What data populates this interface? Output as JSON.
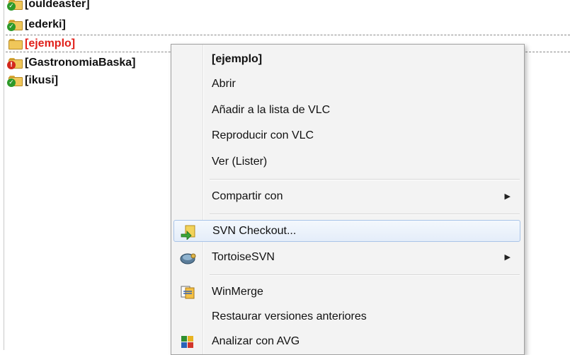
{
  "files": [
    {
      "label": "[ouldeaster]",
      "badge": "ok",
      "selected": false
    },
    {
      "label": "[ederki]",
      "badge": "ok",
      "selected": false
    },
    {
      "label": "[ejemplo]",
      "badge": "none",
      "selected": true
    },
    {
      "label": "[GastronomiaBaska]",
      "badge": "warn",
      "selected": false
    },
    {
      "label": "[ikusi]",
      "badge": "ok",
      "selected": false
    }
  ],
  "context_menu": {
    "items": [
      {
        "label": "[ejemplo]",
        "bold": true
      },
      {
        "label": "Abrir"
      },
      {
        "label": "Añadir a la lista de VLC"
      },
      {
        "label": "Reproducir con VLC"
      },
      {
        "label": "Ver (Lister)"
      },
      {
        "label": "Compartir con",
        "submenu": true
      },
      {
        "label": "SVN Checkout...",
        "highlighted": true,
        "icon": "svn-checkout-icon"
      },
      {
        "label": "TortoiseSVN",
        "submenu": true,
        "icon": "tortoisesvn-icon"
      },
      {
        "label": "WinMerge",
        "icon": "winmerge-icon"
      },
      {
        "label": "Restaurar versiones anteriores"
      },
      {
        "label": "Analizar con AVG",
        "icon": "avg-icon"
      }
    ],
    "submenu_arrow": "▶"
  },
  "colors": {
    "selected_text": "#e0201a",
    "highlight_border": "#a9c4e8",
    "menu_bg": "#f3f3f3"
  }
}
